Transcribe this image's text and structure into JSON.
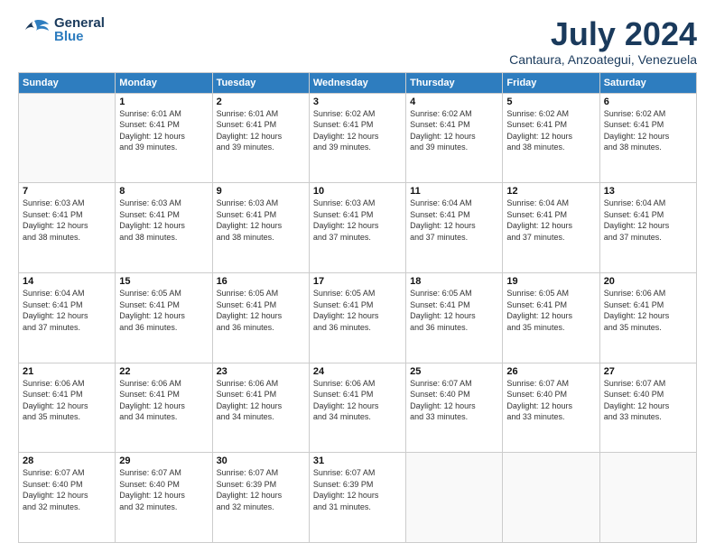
{
  "header": {
    "logo_general": "General",
    "logo_blue": "Blue",
    "main_title": "July 2024",
    "subtitle": "Cantaura, Anzoategui, Venezuela"
  },
  "weekdays": [
    "Sunday",
    "Monday",
    "Tuesday",
    "Wednesday",
    "Thursday",
    "Friday",
    "Saturday"
  ],
  "weeks": [
    [
      {
        "day": "",
        "info": ""
      },
      {
        "day": "1",
        "info": "Sunrise: 6:01 AM\nSunset: 6:41 PM\nDaylight: 12 hours\nand 39 minutes."
      },
      {
        "day": "2",
        "info": "Sunrise: 6:01 AM\nSunset: 6:41 PM\nDaylight: 12 hours\nand 39 minutes."
      },
      {
        "day": "3",
        "info": "Sunrise: 6:02 AM\nSunset: 6:41 PM\nDaylight: 12 hours\nand 39 minutes."
      },
      {
        "day": "4",
        "info": "Sunrise: 6:02 AM\nSunset: 6:41 PM\nDaylight: 12 hours\nand 39 minutes."
      },
      {
        "day": "5",
        "info": "Sunrise: 6:02 AM\nSunset: 6:41 PM\nDaylight: 12 hours\nand 38 minutes."
      },
      {
        "day": "6",
        "info": "Sunrise: 6:02 AM\nSunset: 6:41 PM\nDaylight: 12 hours\nand 38 minutes."
      }
    ],
    [
      {
        "day": "7",
        "info": "Sunrise: 6:03 AM\nSunset: 6:41 PM\nDaylight: 12 hours\nand 38 minutes."
      },
      {
        "day": "8",
        "info": "Sunrise: 6:03 AM\nSunset: 6:41 PM\nDaylight: 12 hours\nand 38 minutes."
      },
      {
        "day": "9",
        "info": "Sunrise: 6:03 AM\nSunset: 6:41 PM\nDaylight: 12 hours\nand 38 minutes."
      },
      {
        "day": "10",
        "info": "Sunrise: 6:03 AM\nSunset: 6:41 PM\nDaylight: 12 hours\nand 37 minutes."
      },
      {
        "day": "11",
        "info": "Sunrise: 6:04 AM\nSunset: 6:41 PM\nDaylight: 12 hours\nand 37 minutes."
      },
      {
        "day": "12",
        "info": "Sunrise: 6:04 AM\nSunset: 6:41 PM\nDaylight: 12 hours\nand 37 minutes."
      },
      {
        "day": "13",
        "info": "Sunrise: 6:04 AM\nSunset: 6:41 PM\nDaylight: 12 hours\nand 37 minutes."
      }
    ],
    [
      {
        "day": "14",
        "info": "Sunrise: 6:04 AM\nSunset: 6:41 PM\nDaylight: 12 hours\nand 37 minutes."
      },
      {
        "day": "15",
        "info": "Sunrise: 6:05 AM\nSunset: 6:41 PM\nDaylight: 12 hours\nand 36 minutes."
      },
      {
        "day": "16",
        "info": "Sunrise: 6:05 AM\nSunset: 6:41 PM\nDaylight: 12 hours\nand 36 minutes."
      },
      {
        "day": "17",
        "info": "Sunrise: 6:05 AM\nSunset: 6:41 PM\nDaylight: 12 hours\nand 36 minutes."
      },
      {
        "day": "18",
        "info": "Sunrise: 6:05 AM\nSunset: 6:41 PM\nDaylight: 12 hours\nand 36 minutes."
      },
      {
        "day": "19",
        "info": "Sunrise: 6:05 AM\nSunset: 6:41 PM\nDaylight: 12 hours\nand 35 minutes."
      },
      {
        "day": "20",
        "info": "Sunrise: 6:06 AM\nSunset: 6:41 PM\nDaylight: 12 hours\nand 35 minutes."
      }
    ],
    [
      {
        "day": "21",
        "info": "Sunrise: 6:06 AM\nSunset: 6:41 PM\nDaylight: 12 hours\nand 35 minutes."
      },
      {
        "day": "22",
        "info": "Sunrise: 6:06 AM\nSunset: 6:41 PM\nDaylight: 12 hours\nand 34 minutes."
      },
      {
        "day": "23",
        "info": "Sunrise: 6:06 AM\nSunset: 6:41 PM\nDaylight: 12 hours\nand 34 minutes."
      },
      {
        "day": "24",
        "info": "Sunrise: 6:06 AM\nSunset: 6:41 PM\nDaylight: 12 hours\nand 34 minutes."
      },
      {
        "day": "25",
        "info": "Sunrise: 6:07 AM\nSunset: 6:40 PM\nDaylight: 12 hours\nand 33 minutes."
      },
      {
        "day": "26",
        "info": "Sunrise: 6:07 AM\nSunset: 6:40 PM\nDaylight: 12 hours\nand 33 minutes."
      },
      {
        "day": "27",
        "info": "Sunrise: 6:07 AM\nSunset: 6:40 PM\nDaylight: 12 hours\nand 33 minutes."
      }
    ],
    [
      {
        "day": "28",
        "info": "Sunrise: 6:07 AM\nSunset: 6:40 PM\nDaylight: 12 hours\nand 32 minutes."
      },
      {
        "day": "29",
        "info": "Sunrise: 6:07 AM\nSunset: 6:40 PM\nDaylight: 12 hours\nand 32 minutes."
      },
      {
        "day": "30",
        "info": "Sunrise: 6:07 AM\nSunset: 6:39 PM\nDaylight: 12 hours\nand 32 minutes."
      },
      {
        "day": "31",
        "info": "Sunrise: 6:07 AM\nSunset: 6:39 PM\nDaylight: 12 hours\nand 31 minutes."
      },
      {
        "day": "",
        "info": ""
      },
      {
        "day": "",
        "info": ""
      },
      {
        "day": "",
        "info": ""
      }
    ]
  ]
}
